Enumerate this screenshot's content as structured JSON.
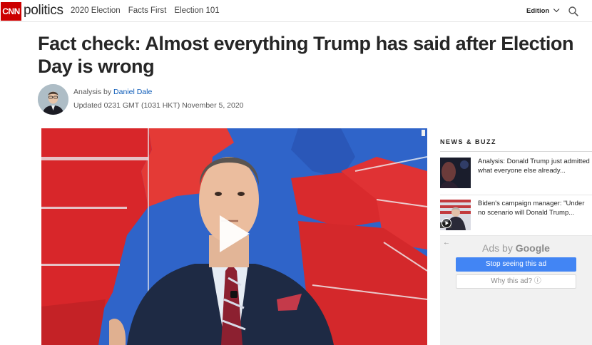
{
  "header": {
    "logo_text": "CNN",
    "section_name": "politics",
    "nav_items": [
      "2020 Election",
      "Facts First",
      "Election 101"
    ],
    "edition_label": "Edition",
    "search_icon": "search-icon"
  },
  "article": {
    "headline": "Fact check: Almost everything Trump has said after Election Day is wrong",
    "byline_prefix": "Analysis by",
    "author": "Daniel Dale",
    "updated": "Updated 0231 GMT (1031 HKT) November 5, 2020"
  },
  "video": {
    "play_icon": "play-icon"
  },
  "sidebar": {
    "heading": "NEWS & BUZZ",
    "items": [
      {
        "text": "Analysis: Donald Trump just admitted what everyone else already..."
      },
      {
        "text": "Biden's campaign manager: \"Under no scenario will Donald Trump..."
      }
    ]
  },
  "ad": {
    "ads_by": "Ads by",
    "google": "Google",
    "stop_label": "Stop seeing this ad",
    "why_label": "Why this ad? ⓘ",
    "accent": "#4285f4"
  },
  "colors": {
    "brand_red": "#cc0000",
    "link_blue": "#0c5bb8"
  }
}
